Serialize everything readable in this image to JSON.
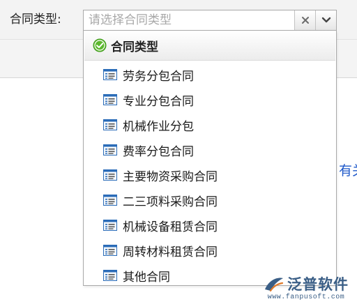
{
  "field": {
    "label": "合同类型:",
    "placeholder": "请选择合同类型",
    "value": ""
  },
  "dropdown": {
    "group_label": "合同类型",
    "options": [
      "劳务分包合同",
      "专业分包合同",
      "机械作业分包",
      "费率分包合同",
      "主要物资采购合同",
      "二三项料采购合同",
      "机械设备租赁合同",
      "周转材料租赁合同",
      "其他合同"
    ]
  },
  "background": {
    "partial_link_text": "有关"
  },
  "watermark": {
    "brand": "泛普软件",
    "url": "www.fanpusoft.com"
  },
  "icons": {
    "clear": "close-icon",
    "toggle": "chevron-down-icon",
    "group": "check-circle-icon",
    "option": "list-item-icon"
  },
  "colors": {
    "group_check": "#5cb82e",
    "link": "#1e58c9",
    "watermark": "#3a5e86",
    "icon_blue": "#2b6cb8"
  }
}
